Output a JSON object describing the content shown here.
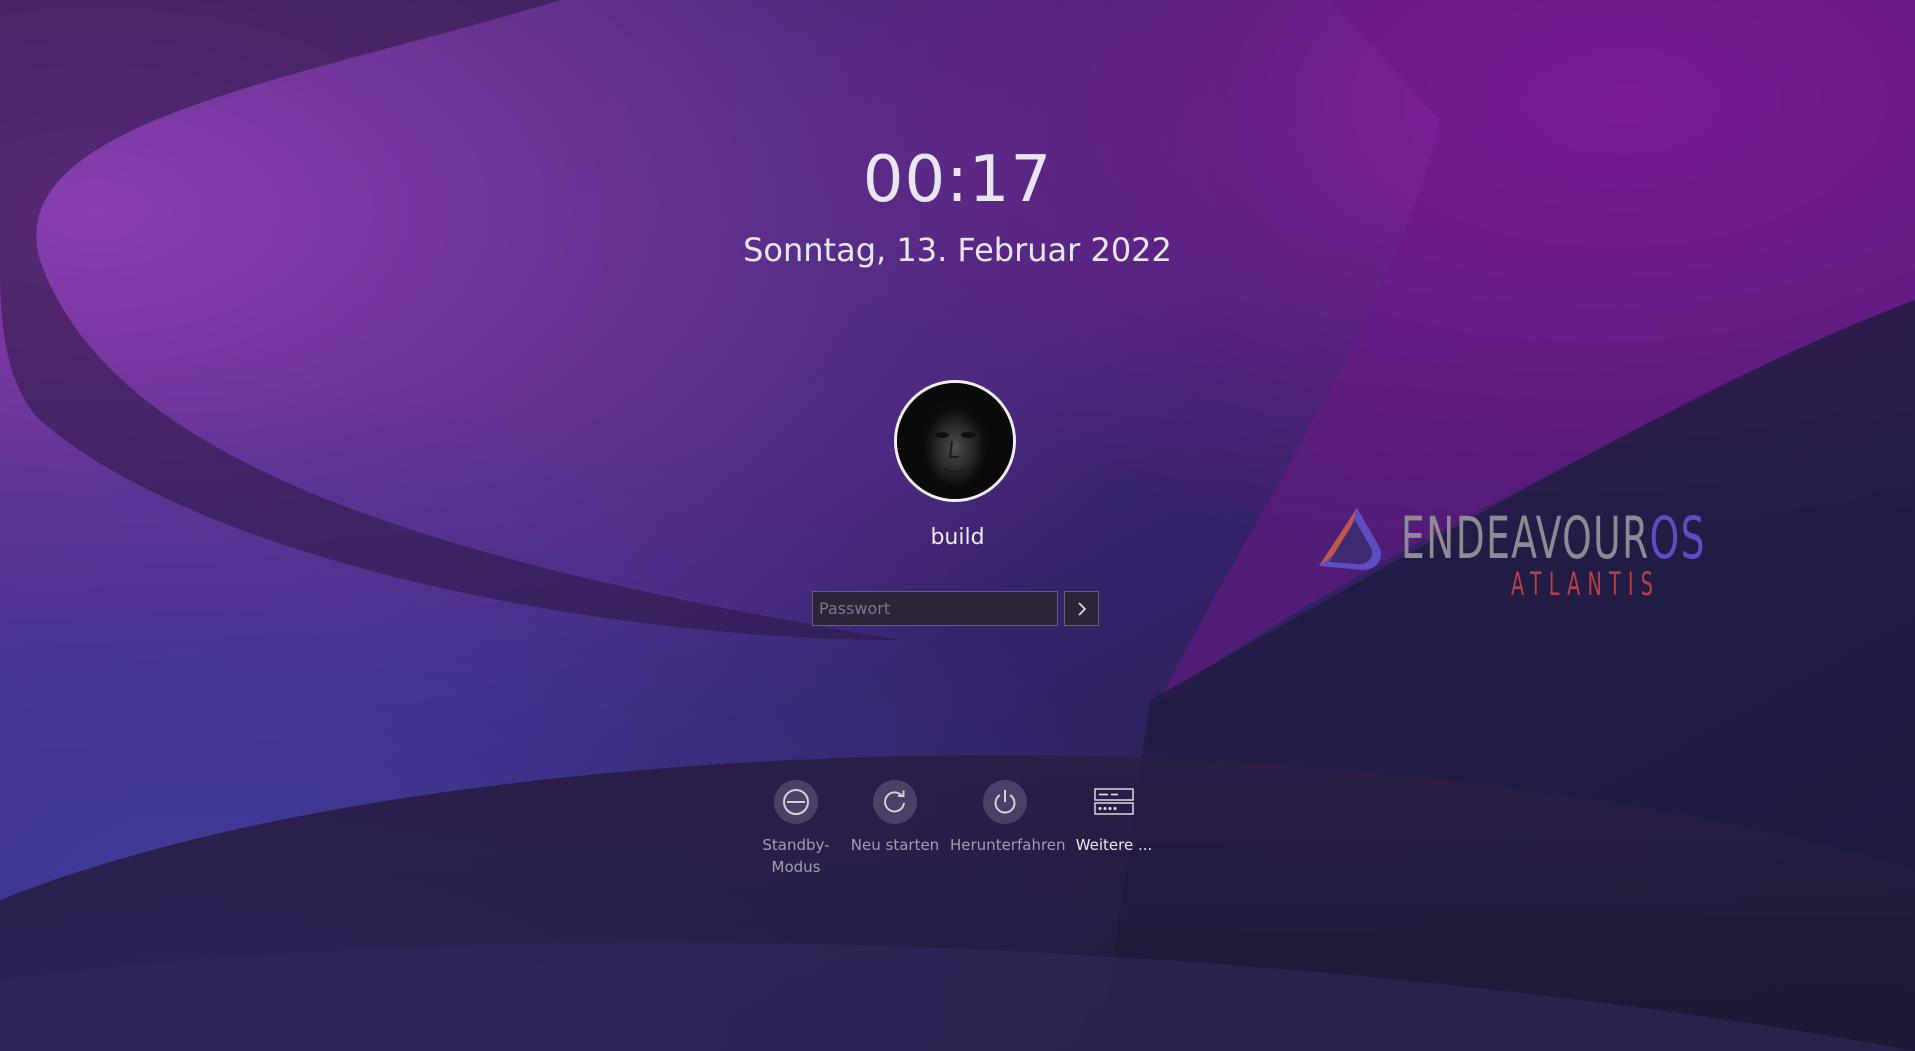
{
  "lockscreen": {
    "time": "00:17",
    "date": "Sonntag, 13. Februar 2022"
  },
  "user": {
    "name": "build"
  },
  "login": {
    "password_placeholder": "Passwort",
    "submit_icon": "chevron-right-icon"
  },
  "actions": [
    {
      "label": "Standby-Modus",
      "icon": "standby-icon"
    },
    {
      "label": "Neu starten",
      "icon": "restart-icon"
    },
    {
      "label": "Herunterfahren",
      "icon": "power-icon"
    },
    {
      "label": "Weitere ...",
      "icon": "switch-user-icon"
    }
  ],
  "branding": {
    "logo_main": "ENDEAVOUR",
    "logo_suffix": "OS",
    "logo_sub": "ATLANTIS"
  },
  "colors": {
    "background_primary": "#4a2a82",
    "background_accent": "#7a1a8a",
    "text": "#e8e6f0",
    "logo_gray": "#8e8a95",
    "logo_blue": "#5b4fc4",
    "logo_red": "#b5414a"
  }
}
